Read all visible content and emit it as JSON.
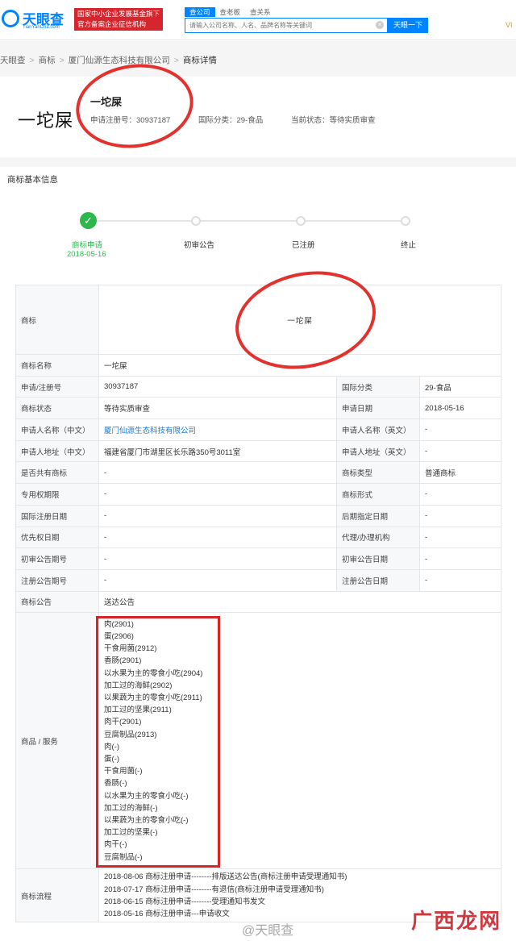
{
  "topbar": {
    "logo_text": "天眼查",
    "logo_sub": "TianYanCha.com",
    "badge_line1": "国家中小企业发展基金旗下",
    "badge_line2": "官方备案企业征信机构",
    "tabs": [
      "查公司",
      "查老板",
      "查关系"
    ],
    "search_placeholder": "请输入公司名称、人名、品牌名称等关键词",
    "search_button": "天眼一下",
    "vip": "VI"
  },
  "breadcrumb": [
    "天眼查",
    "商标",
    "厦门仙源生态科技有限公司",
    "商标详情"
  ],
  "header": {
    "trademark_image_text": "一坨屎",
    "trademark_name": "一坨屎",
    "reg_no": "申请注册号：30937187",
    "intl_class": "国际分类：29-食品",
    "status": "当前状态：等待实质审查"
  },
  "section_title": "商标基本信息",
  "steps": [
    {
      "label": "商标申请",
      "date": "2018-05-16",
      "done": true
    },
    {
      "label": "初审公告",
      "done": false
    },
    {
      "label": "已注册",
      "done": false
    },
    {
      "label": "终止",
      "done": false
    }
  ],
  "table": {
    "mark_label": "商标",
    "mark_image_text": "一坨屎",
    "name_label": "商标名称",
    "name_value": "一坨屎",
    "rows": [
      [
        "申请/注册号",
        "30937187",
        "国际分类",
        "29-食品"
      ],
      [
        "商标状态",
        "等待实质审查",
        "申请日期",
        "2018-05-16"
      ],
      [
        "申请人名称（中文）",
        "厦门仙源生态科技有限公司",
        "申请人名称（英文）",
        "-"
      ],
      [
        "申请人地址（中文）",
        "福建省厦门市湖里区长乐路350号3011室",
        "申请人地址（英文）",
        "-"
      ],
      [
        "是否共有商标",
        "-",
        "商标类型",
        "普通商标"
      ],
      [
        "专用权期限",
        "-",
        "商标形式",
        "-"
      ],
      [
        "国际注册日期",
        "-",
        "后期指定日期",
        "-"
      ],
      [
        "优先权日期",
        "-",
        "代理/办理机构",
        "-"
      ],
      [
        "初审公告期号",
        "-",
        "初审公告日期",
        "-"
      ],
      [
        "注册公告期号",
        "-",
        "注册公告日期",
        "-"
      ]
    ],
    "notice_label": "商标公告",
    "notice_value": "送达公告",
    "goods_label": "商品 / 服务",
    "goods": [
      "肉(2901)",
      "蛋(2906)",
      "干食用菌(2912)",
      "香肠(2901)",
      "以水果为主的零食小吃(2904)",
      "加工过的海鲜(2902)",
      "以果蔬为主的零食小吃(2911)",
      "加工过的坚果(2911)",
      "肉干(2901)",
      "豆腐制品(2913)",
      "肉(-)",
      "蛋(-)",
      "干食用菌(-)",
      "香肠(-)",
      "以水果为主的零食小吃(-)",
      "加工过的海鲜(-)",
      "以果蔬为主的零食小吃(-)",
      "加工过的坚果(-)",
      "肉干(-)",
      "豆腐制品(-)"
    ],
    "flow_label": "商标流程",
    "flow": [
      "2018-08-06 商标注册申请--------排版送达公告(商标注册申请受理通知书)",
      "2018-07-17 商标注册申请--------有退信(商标注册申请受理通知书)",
      "2018-06-15 商标注册申请--------受理通知书发文",
      "2018-05-16 商标注册申请---申请收文"
    ]
  },
  "watermarks": {
    "weibo": "@天眼查",
    "site": "广西龙网"
  },
  "colors": {
    "brand": "#0084ff",
    "success": "#2db84d",
    "annotation_red": "#e3322d",
    "badge_red": "#d6252c"
  }
}
